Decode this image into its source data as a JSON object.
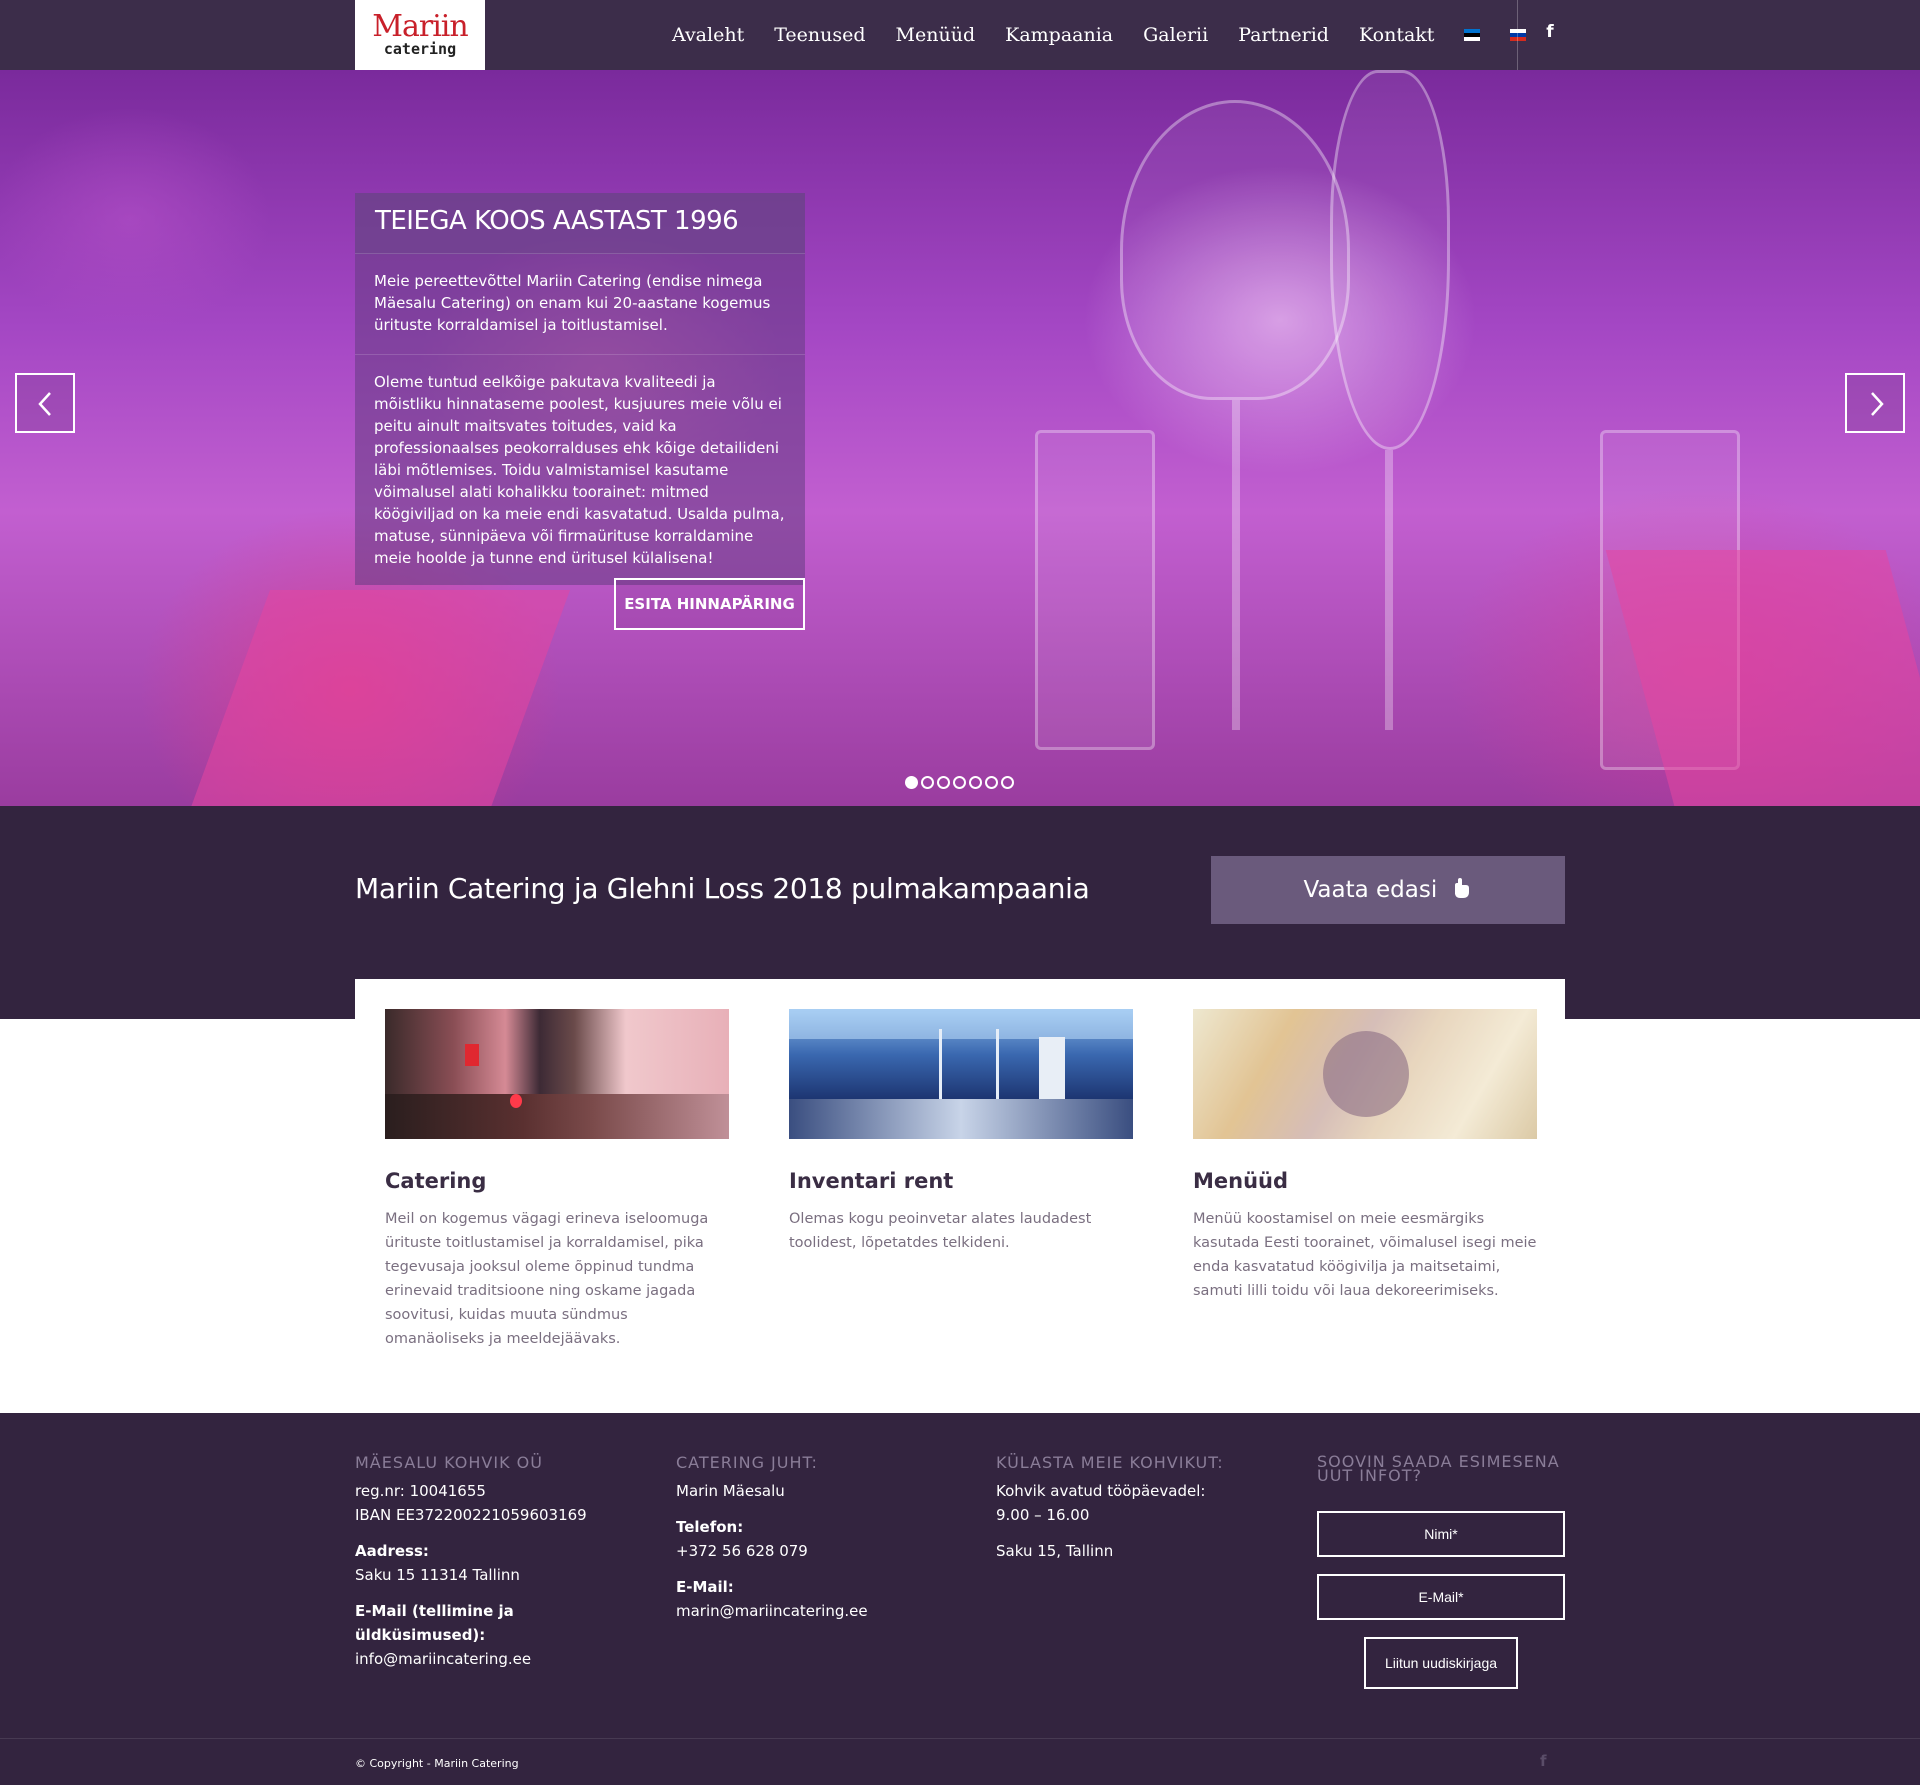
{
  "brand": {
    "logo_main": "Mariin",
    "logo_sub": "catering"
  },
  "nav": {
    "items": [
      {
        "label": "Avaleht"
      },
      {
        "label": "Teenused"
      },
      {
        "label": "Menüüd"
      },
      {
        "label": "Kampaania"
      },
      {
        "label": "Galerii"
      },
      {
        "label": "Partnerid"
      },
      {
        "label": "Kontakt"
      }
    ],
    "flags": [
      "estonian-flag-icon",
      "russian-flag-icon"
    ],
    "social_icon": "facebook-icon",
    "social_label": "f"
  },
  "hero": {
    "title": "TEIEGA KOOS AASTAST 1996",
    "paragraph1": "Meie pereettevõttel Mariin Catering (endise nimega Mäesalu Catering) on enam kui 20-aastane kogemus ürituste korraldamisel ja toitlustamisel.",
    "paragraph2": "Oleme tuntud eelkõige pakutava kvaliteedi ja mõistliku hinnataseme poolest, kusjuures meie võlu ei peitu ainult maitsvates toitudes, vaid ka professionaalses peokorralduses ehk kõige detailideni läbi mõtlemises. Toidu valmistamisel kasutame võimalusel alati kohalikku toorainet: mitmed köögiviljad on ka meie endi kasvatatud. Usalda pulma, matuse, sünnipäeva või firmaürituse korraldamine meie hoolde ja tunne end üritusel külalisena!",
    "button": "ESITA HINNAPÄRING",
    "slide_count": 7,
    "active_slide": 1
  },
  "campaign": {
    "title": "Mariin Catering ja Glehni Loss 2018 pulmakampaania",
    "button": "Vaata edasi",
    "button_icon": "hand-pointer-icon"
  },
  "services": [
    {
      "title": "Catering",
      "text": "Meil on kogemus vägagi erineva iseloomuga ürituste toitlustamisel ja korraldamisel, pika tegevusaja jooksul oleme õppinud tundma erinevaid traditsioone ning oskame jagada soovitusi, kuidas muuta sündmus omanäoliseks ja meeldejäävaks."
    },
    {
      "title": "Inventari rent",
      "text": "Olemas  kogu peoinvetar  alates laudadest toolidest, lõpetatdes telkideni."
    },
    {
      "title": "Menüüd",
      "text": "Menüü koostamisel on meie eesmärgiks kasutada Eesti toorainet, võimalusel isegi meie enda kasvatatud köögivilja ja maitsetaimi, samuti lilli toidu või laua dekoreerimiseks."
    }
  ],
  "footer": {
    "col1": {
      "heading": "MÄESALU KOHVIK OÜ",
      "reg": "reg.nr: 10041655",
      "iban": "IBAN EE372200221059603169",
      "address_label": "Aadress:",
      "address": "Saku 15 11314 Tallinn",
      "email_label": "E-Mail (tellimine ja üldküsimused):",
      "email": "info@mariincatering.ee"
    },
    "col2": {
      "heading": "CATERING JUHT:",
      "name": "Marin Mäesalu",
      "phone_label": "Telefon:",
      "phone": "+372 56 628 079",
      "email_label": "E-Mail:",
      "email": "marin@mariincatering.ee"
    },
    "col3": {
      "heading": "KÜLASTA MEIE KOHVIKUT:",
      "hours_label": "Kohvik avatud tööpäevadel:",
      "hours": "9.00 – 16.00",
      "address": "Saku 15, Tallinn"
    },
    "col4": {
      "heading_line1": "SOOVIN SAADA ESIMESENA",
      "heading_line2": "UUT INFOT?",
      "name_placeholder": "Nimi*",
      "email_placeholder": "E-Mail*",
      "submit": "Liitun uudiskirjaga"
    },
    "copyright": "© Copyright - Mariin Catering",
    "social_label": "f"
  }
}
